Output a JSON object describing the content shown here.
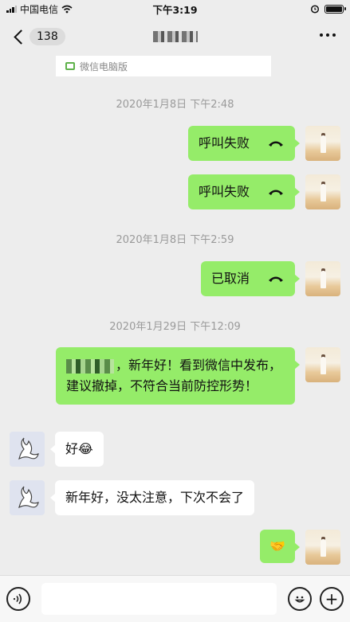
{
  "status_bar": {
    "carrier": "中国电信",
    "time": "下午3:19"
  },
  "nav": {
    "back_badge": "138"
  },
  "banner": {
    "label": "微信电脑版"
  },
  "timestamps": [
    "2020年1月8日 下午2:48",
    "2020年1月8日 下午2:59",
    "2020年1月29日 下午12:09"
  ],
  "messages": [
    {
      "side": "me",
      "type": "call",
      "text": "呼叫失败",
      "icon": "hangup-phone-icon"
    },
    {
      "side": "me",
      "type": "call",
      "text": "呼叫失败",
      "icon": "hangup-phone-icon"
    },
    {
      "side": "me",
      "type": "call",
      "text": "已取消",
      "icon": "hangup-phone-icon"
    },
    {
      "side": "me",
      "type": "text",
      "text": "，新年好！看到微信中发布，建议撤掉，不符合当前防控形势！"
    },
    {
      "side": "them",
      "type": "text",
      "text": "好",
      "emoji": "😂"
    },
    {
      "side": "them",
      "type": "text",
      "text": "新年好，没太注意，下次不会了"
    },
    {
      "side": "me",
      "type": "emoji",
      "emoji": "🤝"
    }
  ],
  "input_bar": {
    "voice_icon": "voice-icon",
    "emoji_icon": "emoji-icon",
    "add_icon": "plus-icon",
    "plus_glyph": "+"
  },
  "colors": {
    "my_bubble": "#95ec69",
    "their_bubble": "#ffffff",
    "background": "#ededed"
  }
}
